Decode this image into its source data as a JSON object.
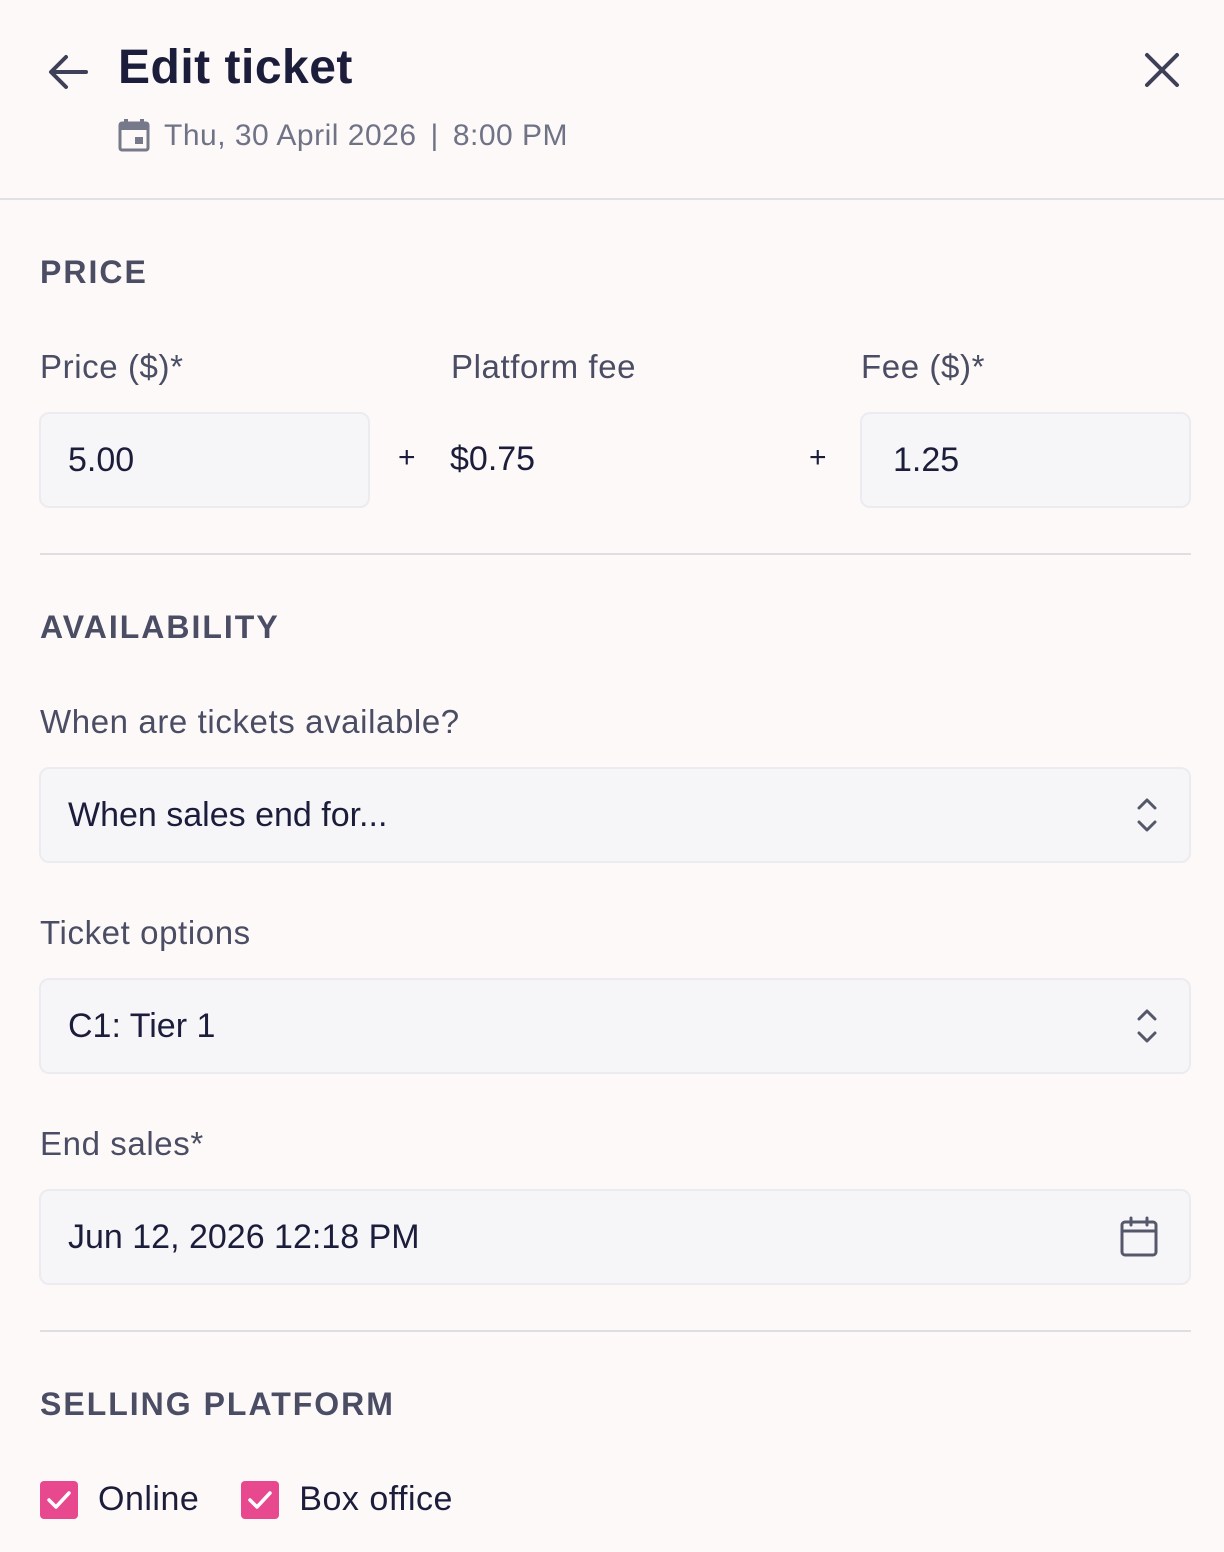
{
  "header": {
    "title": "Edit ticket",
    "date": "Thu, 30 April 2026",
    "separator": "|",
    "time": "8:00 PM"
  },
  "price": {
    "section_title": "PRICE",
    "price_label": "Price ($)*",
    "price_value": "5.00",
    "platform_fee_label": "Platform fee",
    "platform_fee_value": "$0.75",
    "fee_label": "Fee ($)*",
    "fee_value": "1.25",
    "plus": "+"
  },
  "availability": {
    "section_title": "AVAILABILITY",
    "when_label": "When are tickets available?",
    "when_value": "When sales end for...",
    "options_label": "Ticket options",
    "options_value": "C1: Tier 1",
    "end_sales_label": "End sales*",
    "end_sales_value": "Jun 12, 2026 12:18 PM"
  },
  "selling_platform": {
    "section_title": "SELLING PLATFORM",
    "options": [
      {
        "label": "Online",
        "checked": true
      },
      {
        "label": "Box office",
        "checked": true
      }
    ]
  },
  "colors": {
    "accent": "#e8488d",
    "background": "#fdf9f8",
    "title": "#1b1d3b"
  },
  "icons": [
    "back-arrow-icon",
    "close-icon",
    "calendar-icon",
    "select-chevrons-icon",
    "checkmark-icon"
  ]
}
